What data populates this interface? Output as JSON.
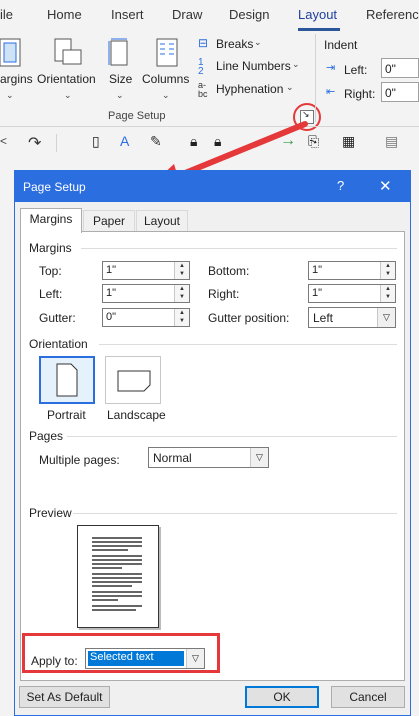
{
  "ribbon": {
    "tabs": [
      "ile",
      "Home",
      "Insert",
      "Draw",
      "Design",
      "Layout",
      "Referenc"
    ],
    "active_tab": "Layout",
    "margins_label": "argins",
    "orientation_label": "Orientation",
    "size_label": "Size",
    "columns_label": "Columns",
    "breaks_label": "Breaks",
    "line_numbers_label": "Line Numbers",
    "hyphenation_label": "Hyphenation",
    "group_label": "Page Setup",
    "indent_label": "Indent",
    "left_label": "Left:",
    "left_value": "0\"",
    "right_label": "Right:",
    "right_value": "0\""
  },
  "dialog": {
    "title": "Page Setup",
    "help": "?",
    "close": "✕",
    "tabs": [
      "Margins",
      "Paper",
      "Layout"
    ],
    "active_tab": "Margins",
    "margins_section": "Margins",
    "top_label": "Top:",
    "top_value": "1\"",
    "bottom_label": "Bottom:",
    "bottom_value": "1\"",
    "left_label": "Left:",
    "left_value": "1\"",
    "right_label": "Right:",
    "right_value": "1\"",
    "gutter_label": "Gutter:",
    "gutter_value": "0\"",
    "gutter_pos_label": "Gutter position:",
    "gutter_pos_value": "Left",
    "orientation_section": "Orientation",
    "portrait_label": "Portrait",
    "landscape_label": "Landscape",
    "pages_section": "Pages",
    "multiple_pages_label": "Multiple pages:",
    "multiple_pages_value": "Normal",
    "preview_section": "Preview",
    "apply_to_label": "Apply to:",
    "apply_to_value": "Selected text",
    "set_default_label": "Set As Default",
    "ok_label": "OK",
    "cancel_label": "Cancel"
  },
  "colors": {
    "accent": "#2b6ee0",
    "annotation": "#e5383b"
  }
}
